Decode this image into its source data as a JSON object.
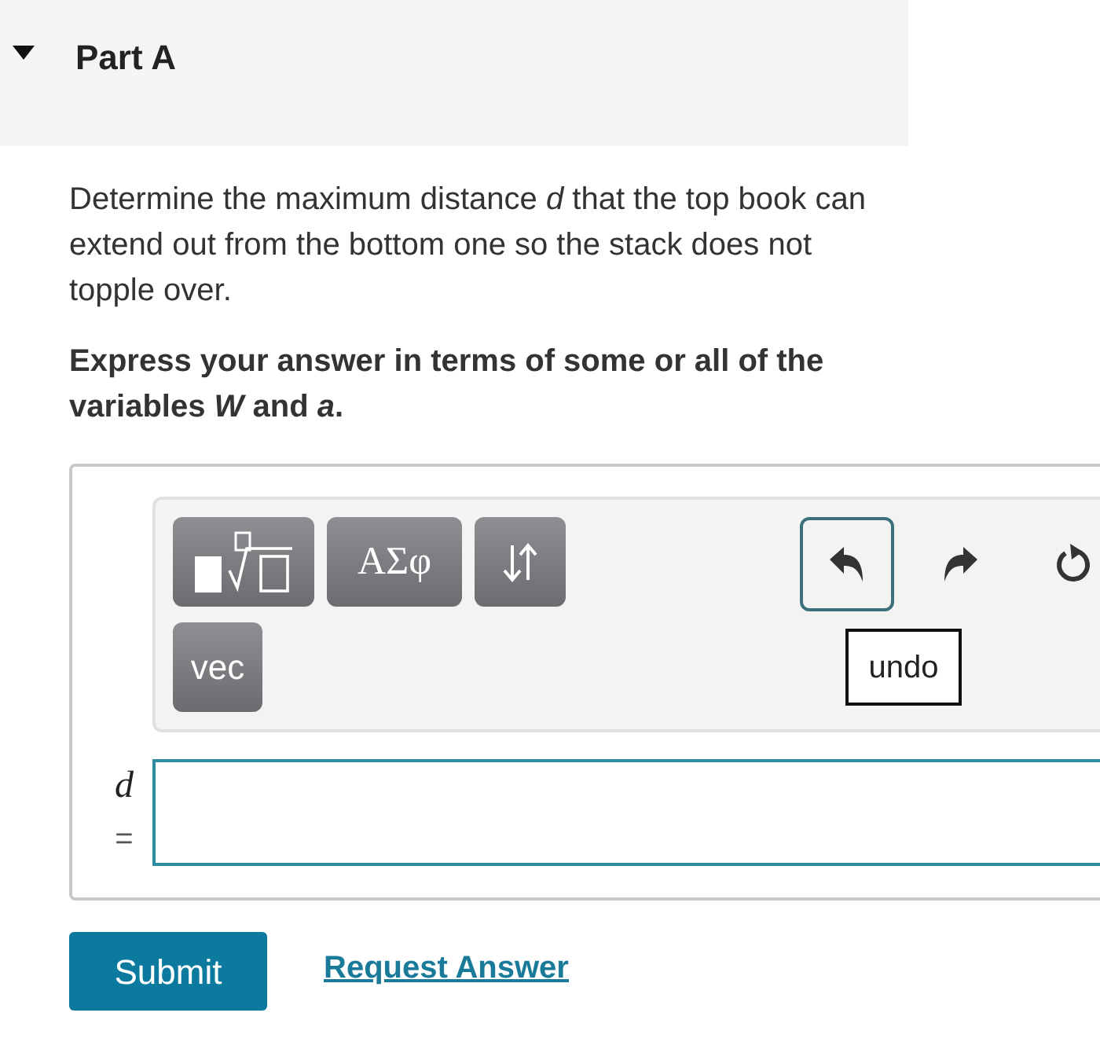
{
  "part": {
    "title": "Part A",
    "expanded": true
  },
  "question": "Determine the maximum distance *d* that the top book can extend out from the bottom one so the stack does not topple over.",
  "instruction": "Express your answer in terms of some or all of the variables *W* and *a*.",
  "toolbar": {
    "buttons": [
      {
        "kind": "templates"
      },
      {
        "kind": "text",
        "label": "ΑΣφ"
      },
      {
        "kind": "arrows"
      },
      {
        "kind": "text",
        "label": "vec"
      }
    ],
    "actions": [
      {
        "kind": "undo",
        "focused": true
      },
      {
        "kind": "redo",
        "focused": false
      },
      {
        "kind": "reset",
        "focused": false
      }
    ],
    "tooltip": "undo"
  },
  "answer": {
    "label": "d",
    "equals": "="
  },
  "submit": "Submit",
  "request_answer": "Request Answer"
}
